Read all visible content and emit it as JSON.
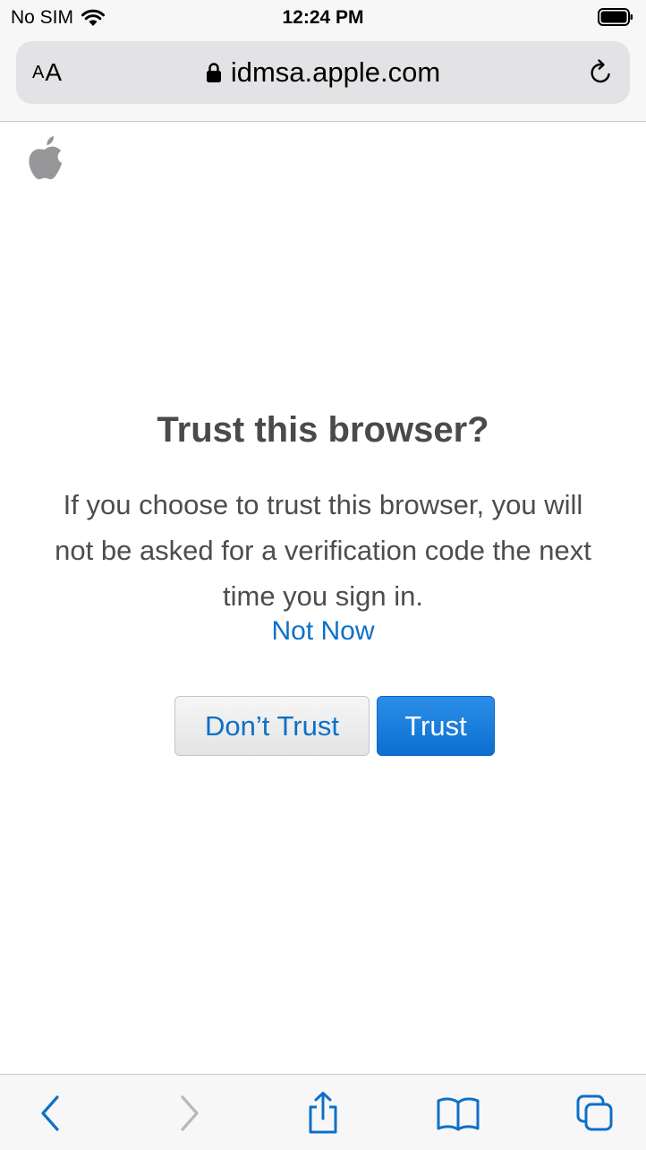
{
  "status_bar": {
    "carrier": "No SIM",
    "time": "12:24 PM"
  },
  "address_bar": {
    "text_size_label_small": "A",
    "text_size_label_large": "A",
    "url": "idmsa.apple.com"
  },
  "dialog": {
    "title": "Trust this browser?",
    "message": "If you choose to trust this browser, you will not be asked for a verification code the next time you sign in.",
    "not_now_label": "Not Now",
    "dont_trust_label": "Don’t Trust",
    "trust_label": "Trust"
  },
  "toolbar": {
    "icons": [
      "back-icon",
      "forward-icon",
      "share-icon",
      "bookmarks-icon",
      "tabs-icon"
    ]
  },
  "colors": {
    "accent": "#0d70c8",
    "title_text": "#4a4a4c",
    "body_text": "#4d4d50",
    "disabled_icon": "#b8b8bc"
  }
}
